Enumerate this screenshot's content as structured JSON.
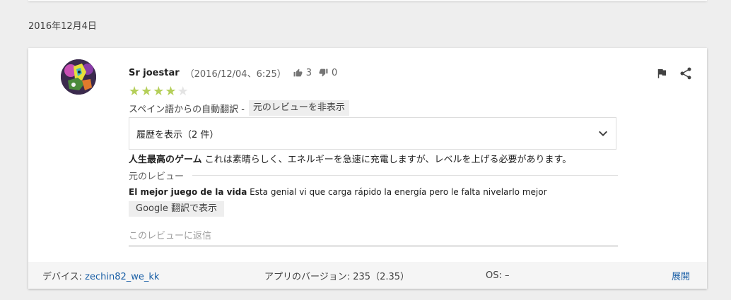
{
  "date_heading": "2016年12月4日",
  "review": {
    "author": "Sr joestar",
    "timestamp": "（2016/12/04、6:25）",
    "thumbs_up_count": "3",
    "thumbs_down_count": "0",
    "rating": 4,
    "rating_max": 5,
    "auto_translate_label": "スペイン語からの自動翻訳 -",
    "hide_original_button": "元のレビューを非表示",
    "history_label": "履歴を表示（2 件）",
    "translated_title": "人生最高のゲーム",
    "translated_body": "これは素晴らしく、エネルギーを急速に充電しますが、レベルを上げる必要があります。",
    "original_label": "元のレビュー",
    "original_title": "El mejor juego de la vida",
    "original_body": "Esta genial vi que carga rápido la energía pero le falta nivelarlo mejor",
    "google_translate_button": "Google 翻訳で表示",
    "reply_placeholder": "このレビューに返信"
  },
  "footer": {
    "device_label": "デバイス:",
    "device_value": "zechin82_we_kk",
    "version_label": "アプリのバージョン:",
    "version_value": "235（2.35）",
    "os_label": "OS:",
    "os_value": "–",
    "expand_label": "展開"
  },
  "colors": {
    "star_on": "#b5cf5a",
    "star_off": "#e4e4e4",
    "link": "#1a5fa6"
  }
}
